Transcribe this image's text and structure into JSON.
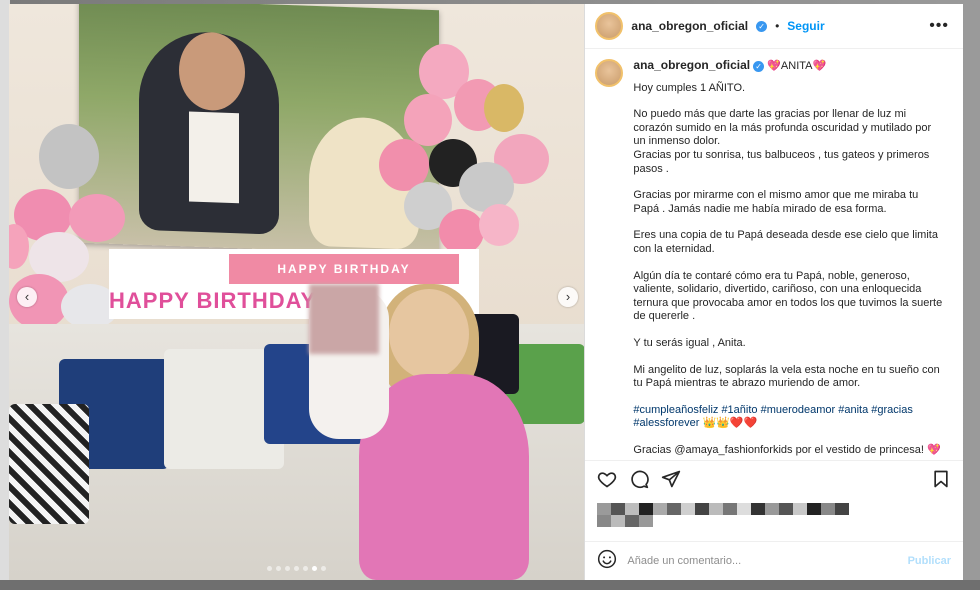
{
  "post": {
    "username": "ana_obregon_oficial",
    "verified_icon": "verified-badge-icon",
    "follow_label": "Seguir",
    "more_label": "•••"
  },
  "caption": {
    "username": "ana_obregon_oficial",
    "title": "💖ANITA💖",
    "paragraphs": [
      "Hoy cumples 1 AÑITO.",
      "No puedo más que darte las gracias por llenar de luz mi corazón sumido en la más profunda oscuridad y mutilado por un inmenso dolor.\nGracias por tu sonrisa, tus balbuceos , tus gateos y primeros pasos .",
      "Gracias por mirarme con el mismo amor que me miraba tu Papá . Jamás nadie me había mirado de esa forma.",
      "Eres una copia de tu Papá deseada desde ese cielo que limita con la eternidad.",
      "Algún día te contaré cómo era tu Papá, noble, generoso, valiente, solidario, divertido, cariñoso, con una enloquecida ternura que provocaba amor en todos los que tuvimos la suerte de quererle .",
      "Y tu serás igual , Anita.",
      "Mi angelito de luz, soplarás la vela esta noche en tu sueño con tu Papá mientras te abrazo muriendo de amor."
    ],
    "hashtags": "#cumpleañosfeliz #1añito #muerodeamor #anita #gracias #alessforever 👑👑❤️❤️",
    "last_line": "Gracias @amaya_fashionforkids por el vestido de princesa! 💖"
  },
  "media": {
    "banner_text": "HAPPY BIRTHDAY",
    "banner_text_lower": "HAPPY BIRTHDAY",
    "prev_icon": "chevron-left-icon",
    "next_icon": "chevron-right-icon",
    "slide_count": 7,
    "active_slide": 5
  },
  "actions": {
    "like_icon": "heart-icon",
    "comment_icon": "comment-icon",
    "share_icon": "share-icon",
    "save_icon": "bookmark-icon"
  },
  "comment_box": {
    "placeholder": "Añade un comentario...",
    "publish_label": "Publicar",
    "emoji_icon": "emoji-icon"
  },
  "colors": {
    "follow": "#0095f6",
    "hashtag": "#00376b",
    "publish_disabled": "#b2dffc"
  }
}
